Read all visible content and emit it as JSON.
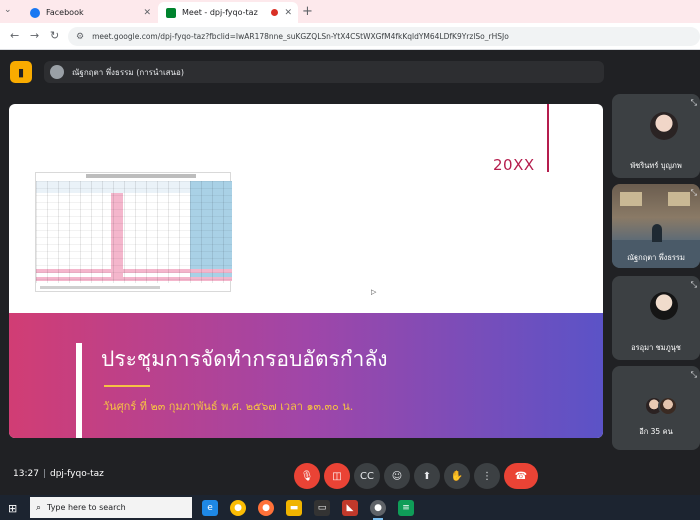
{
  "browser": {
    "tabs": [
      {
        "label": "Facebook",
        "favicon_color": "#1877f2"
      },
      {
        "label": "Meet - dpj-fyqo-taz",
        "favicon_color": "#00832d",
        "active": true
      }
    ],
    "new_tab": "+",
    "url": "meet.google.com/dpj-fyqo-taz?fbclid=IwAR178nne_suKGZQLSn-YtX4CStWXGfM4fkKqldYM64LDfK9YrzlSo_rHSJo"
  },
  "meet": {
    "presenter_name": "ณัฐกฤตา พึ่งธรรม (การนำเสนอ)",
    "slide": {
      "year": "20XX",
      "title": "ประชุมการจัดทำกรอบอัตรกำลัง",
      "date": "วันศุกร์ ที่ ๒๓ กุมภาพันธ์ พ.ศ. ๒๕๖๗ เวลา ๑๓.๓๐ น."
    },
    "participants": [
      {
        "name": "พัชรินทร์ บุญภพ"
      },
      {
        "name": "ณัฐกฤตา พึ่งธรรม"
      },
      {
        "name": "อรอุมา ชมภูนุช"
      },
      {
        "name": "อีก 35 คน"
      }
    ],
    "time": "13:27",
    "meeting_code": "dpj-fyqo-taz",
    "colors": {
      "accent_red": "#ea4335",
      "banner_start": "#d13d74",
      "banner_end": "#5b53c7",
      "date_gold": "#f6c244"
    }
  },
  "taskbar": {
    "search_placeholder": "Type here to search"
  }
}
